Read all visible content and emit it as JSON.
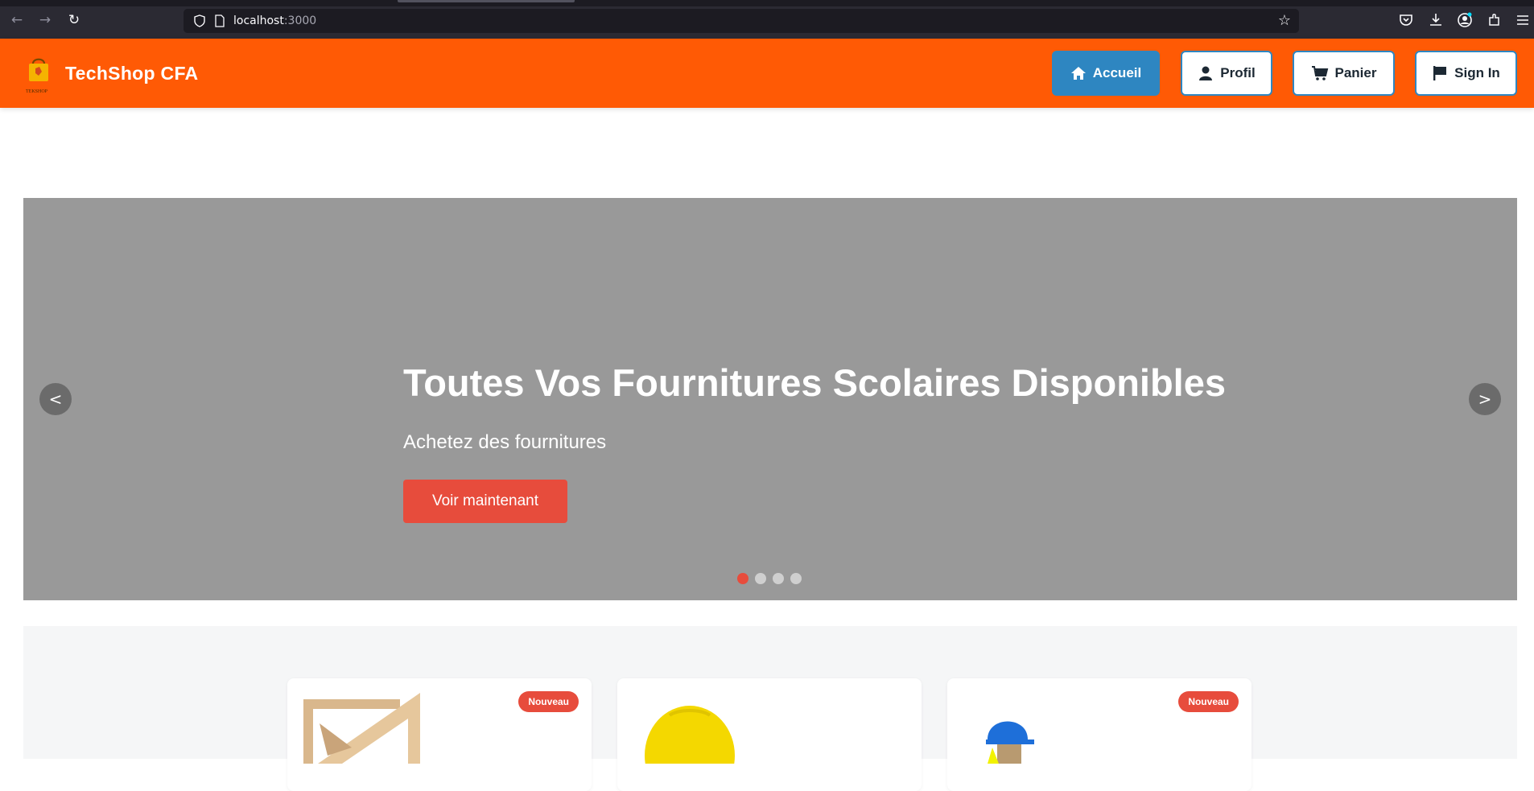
{
  "browser": {
    "url_host": "localhost",
    "url_port": ":3000"
  },
  "header": {
    "brand": "TechShop CFA",
    "logo_caption": "TEKSHOP",
    "nav": [
      {
        "label": "Accueil",
        "icon": "home-icon",
        "active": true
      },
      {
        "label": "Profil",
        "icon": "user-icon",
        "active": false
      },
      {
        "label": "Panier",
        "icon": "cart-icon",
        "active": false
      },
      {
        "label": "Sign In",
        "icon": "flag-icon",
        "active": false
      }
    ]
  },
  "hero": {
    "title": "Toutes Vos Fournitures Scolaires Disponibles",
    "subtitle": "Achetez des fournitures",
    "cta": "Voir maintenant",
    "prev": "<",
    "next": ">",
    "slide_count": 4,
    "active_slide": 1
  },
  "products": {
    "cards": [
      {
        "badge": "Nouveau",
        "image": "ruler-set-square"
      },
      {
        "badge": "",
        "image": "yellow-hard-hat"
      },
      {
        "badge": "Nouveau",
        "image": "blue-hard-hat-figure"
      }
    ]
  },
  "colors": {
    "header_bg": "#ff5a05",
    "nav_active": "#2e86c1",
    "cta": "#e74c3c",
    "hero_bg": "#999999"
  }
}
